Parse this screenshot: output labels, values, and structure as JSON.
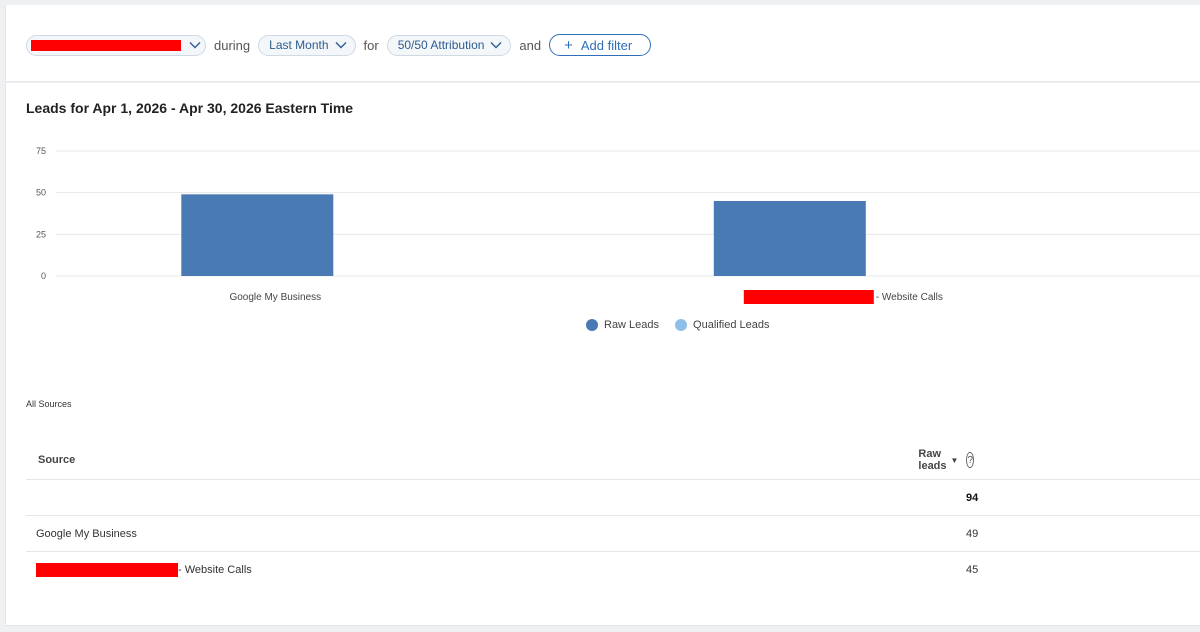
{
  "filters": {
    "during_label": "during",
    "period": "Last Month",
    "for_label": "for",
    "attribution": "50/50 Attribution",
    "and_label": "and",
    "add_filter": "Add filter",
    "add_filter_icon": "plus-icon"
  },
  "chart_title": "Leads for Apr 1, 2026 - Apr 30, 2026 Eastern Time",
  "chart_data": {
    "type": "bar",
    "categories": [
      "Google My Business",
      "- Website Calls"
    ],
    "series": [
      {
        "name": "Raw Leads",
        "values": [
          49,
          45
        ],
        "color": "#4a7ab3"
      },
      {
        "name": "Qualified Leads",
        "values": [
          0,
          0
        ],
        "color": "#8fbfe9"
      }
    ],
    "ylim": [
      0,
      75
    ],
    "yticks": [
      0,
      25,
      50,
      75
    ],
    "grid": true,
    "legend": "bottom-center"
  },
  "legend": {
    "raw": "Raw Leads",
    "qualified": "Qualified Leads"
  },
  "colors": {
    "raw": "#4a7ab3",
    "qualified": "#8fbfe9",
    "accent": "#2f6fba"
  },
  "table": {
    "section_label": "All Sources",
    "header_source": "Source",
    "header_raw": "Raw leads",
    "sort_icon": "sort-desc-icon",
    "help_icon": "question-circle-icon",
    "help_glyph": "?",
    "total": "94",
    "rows": [
      {
        "source": "Google My Business",
        "raw": "49"
      },
      {
        "source": "- Website Calls",
        "raw": "45"
      }
    ]
  }
}
